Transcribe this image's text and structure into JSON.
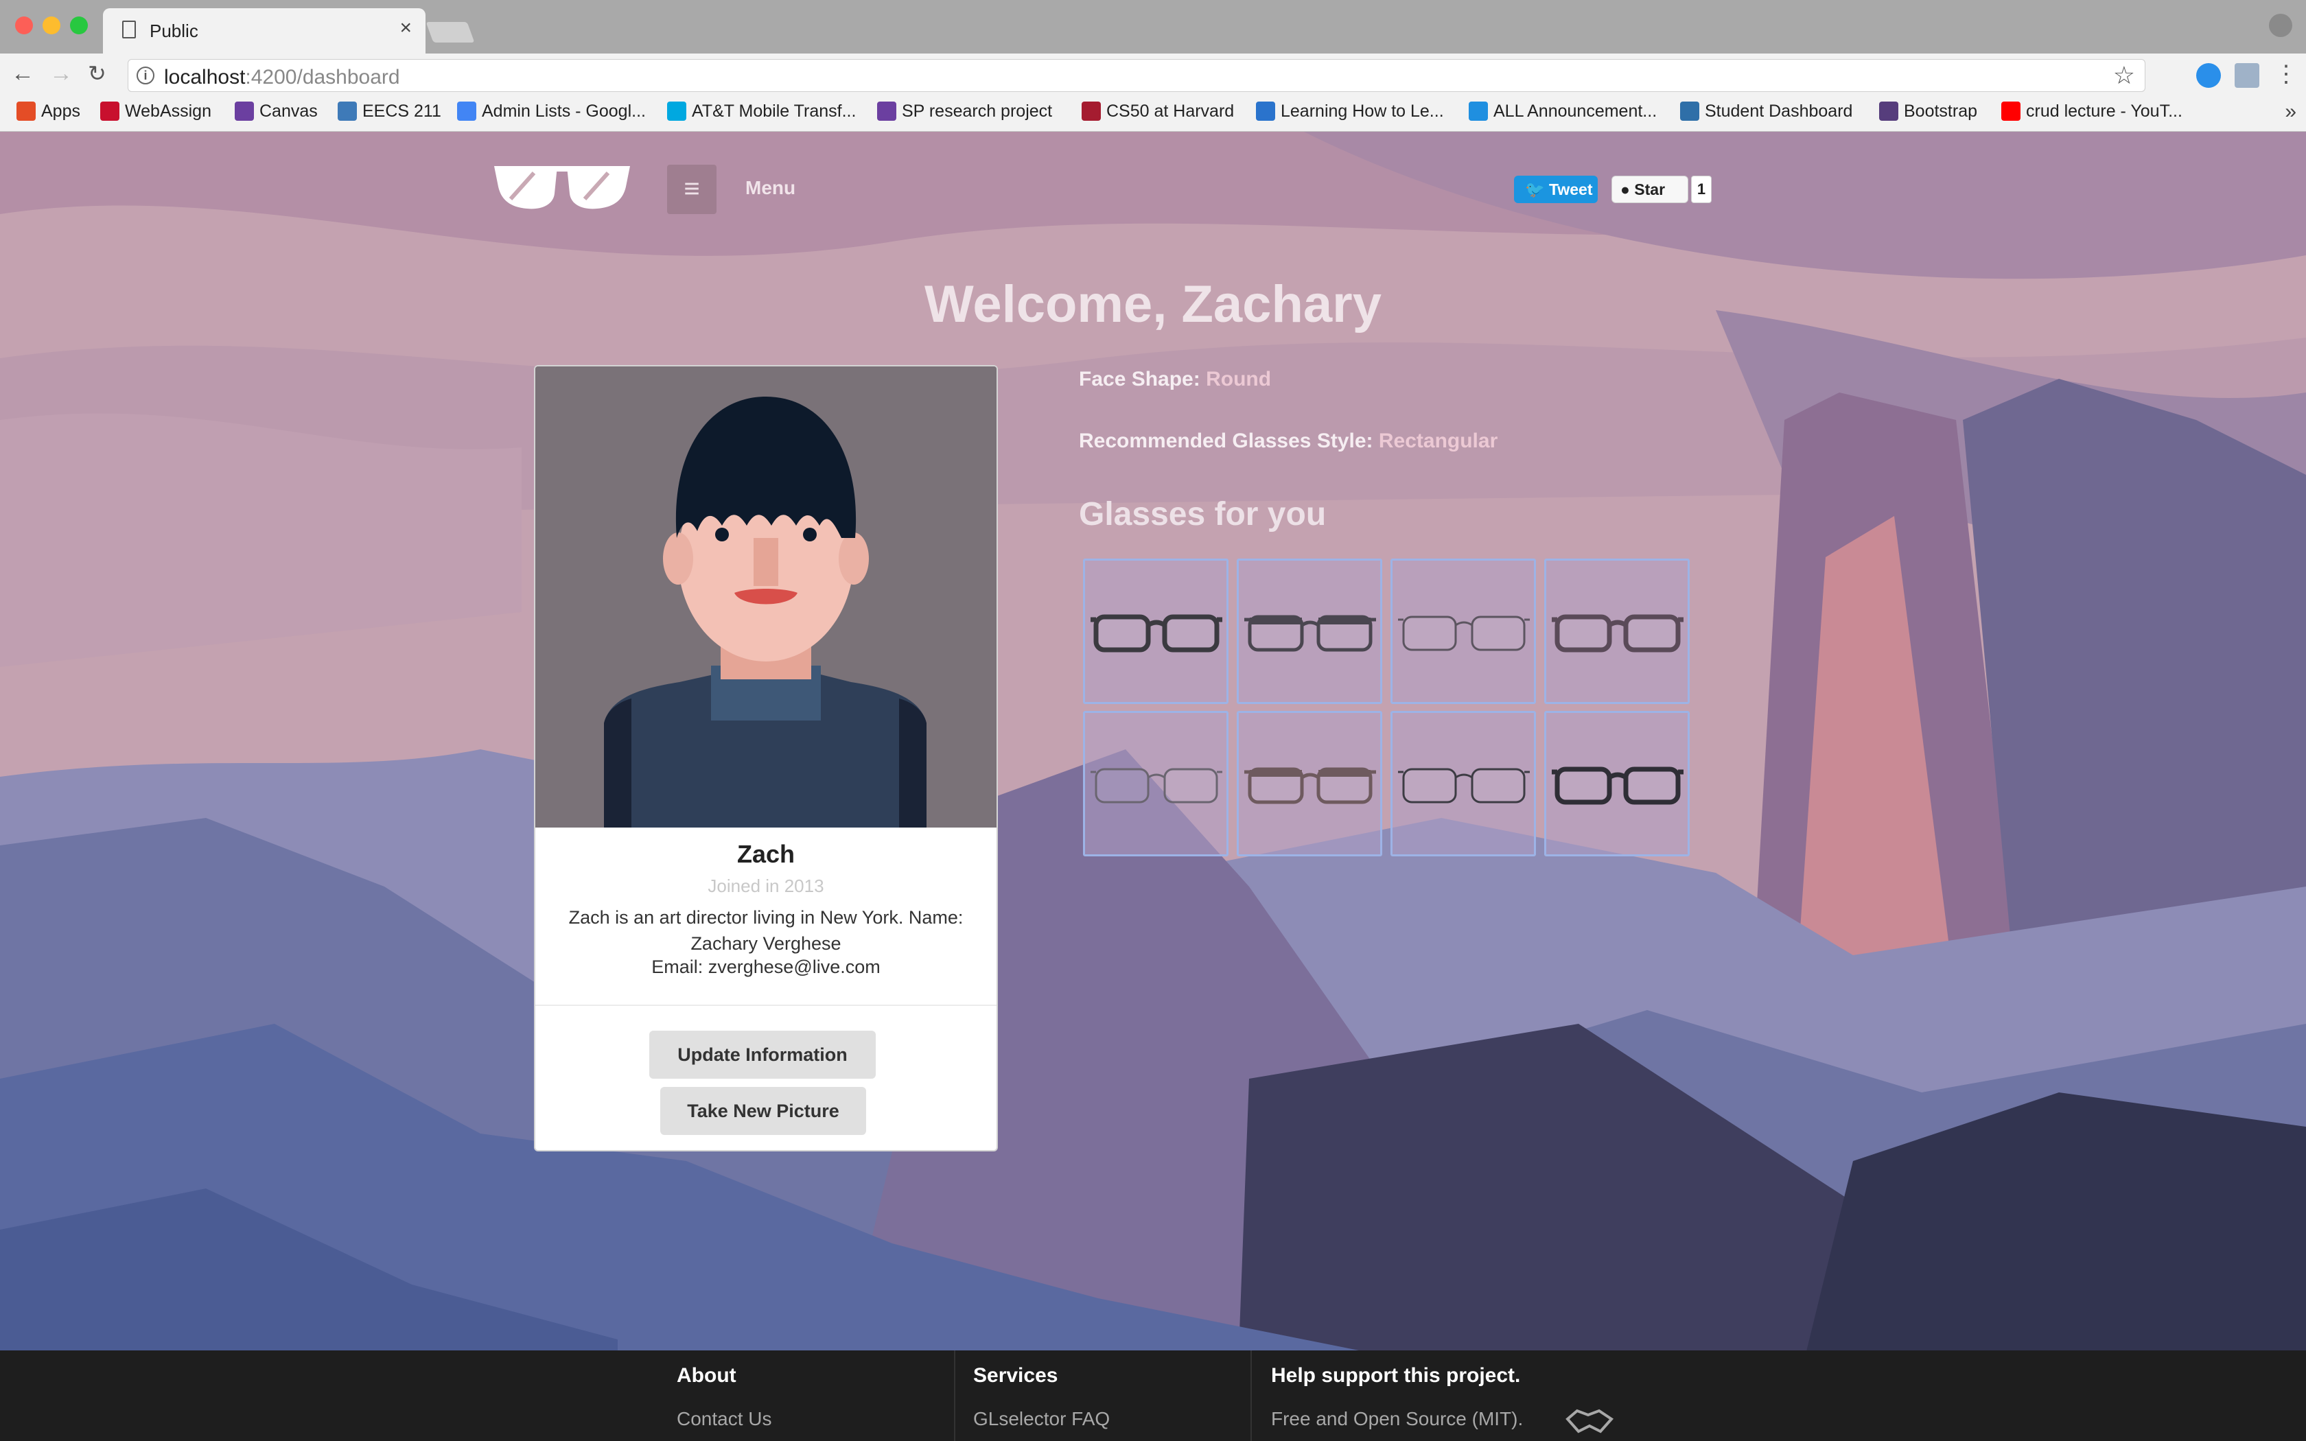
{
  "browser": {
    "tab_title": "Public",
    "url_host": "localhost",
    "url_path": ":4200/dashboard",
    "bookmarks": [
      {
        "label": "Apps",
        "icon": "apps-grid-icon",
        "color": "#e44d26"
      },
      {
        "label": "WebAssign",
        "icon": "webassign-icon",
        "color": "#c8102e"
      },
      {
        "label": "Canvas",
        "icon": "canvas-icon",
        "color": "#6b3fa0"
      },
      {
        "label": "EECS 211",
        "icon": "piazza-icon",
        "color": "#3e7ab8"
      },
      {
        "label": "Admin Lists - Googl...",
        "icon": "google-icon",
        "color": "#4285f4"
      },
      {
        "label": "AT&T Mobile Transf...",
        "icon": "att-icon",
        "color": "#00a8e0"
      },
      {
        "label": "SP research project",
        "icon": "canvas-icon",
        "color": "#6b3fa0"
      },
      {
        "label": "CS50 at Harvard",
        "icon": "harvard-shield-icon",
        "color": "#a51c30"
      },
      {
        "label": "Learning How to Le...",
        "icon": "coursera-icon",
        "color": "#2a73cc"
      },
      {
        "label": "ALL Announcement...",
        "icon": "announcement-icon",
        "color": "#1f8fe0"
      },
      {
        "label": "Student Dashboard",
        "icon": "dashboard-icon",
        "color": "#2f6fa8"
      },
      {
        "label": "Bootstrap",
        "icon": "bootstrap-icon",
        "color": "#563d7c"
      },
      {
        "label": "crud lecture - YouT...",
        "icon": "youtube-icon",
        "color": "#ff0000"
      }
    ]
  },
  "header": {
    "menu_label": "Menu",
    "tweet_label": "Tweet",
    "star_label": "Star",
    "star_count": "1"
  },
  "welcome": "Welcome, Zachary",
  "profile": {
    "name": "Zach",
    "joined": "Joined in 2013",
    "description": "Zach is an art director living in New York. Name: Zachary Verghese",
    "email": "Email: zverghese@live.com",
    "update_label": "Update Information",
    "picture_label": "Take New Picture"
  },
  "recommendation": {
    "face_shape_label": "Face Shape:",
    "face_shape_value": "Round",
    "style_label": "Recommended Glasses Style:",
    "style_value": "Rectangular",
    "heading": "Glasses for you",
    "glasses": [
      {
        "frame_color": "#3b3a40",
        "rim": "thick"
      },
      {
        "frame_color": "#4a4650",
        "rim": "browline"
      },
      {
        "frame_color": "#5c5560",
        "rim": "thin"
      },
      {
        "frame_color": "#5a4a58",
        "rim": "thick"
      },
      {
        "frame_color": "#6a6570",
        "rim": "thin"
      },
      {
        "frame_color": "#6e5a5e",
        "rim": "browline"
      },
      {
        "frame_color": "#3d3c44",
        "rim": "thin"
      },
      {
        "frame_color": "#2f2e36",
        "rim": "thick"
      }
    ]
  },
  "footer": {
    "about_title": "About",
    "about_link": "Contact Us",
    "services_title": "Services",
    "services_link": "GLselector FAQ",
    "support_title": "Help support this project.",
    "support_link": "Free and Open Source (MIT)."
  },
  "colors": {
    "background_sky": "#c9a9b4",
    "mountains": "#6a6f9c",
    "tweet_blue": "#1b95e0",
    "grid_border": "#9db3e6",
    "footer": "#1e1e1e"
  }
}
